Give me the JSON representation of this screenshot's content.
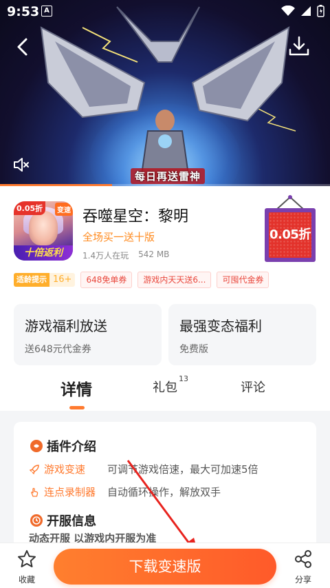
{
  "status_bar": {
    "time": "9:53",
    "a_indicator": "A"
  },
  "hero": {
    "caption": "每日再送雷神",
    "video_progress": 0.34,
    "icons": {
      "back": "back-arrow-icon",
      "download": "download-icon",
      "mute": "mute-icon"
    }
  },
  "app": {
    "title": "吞噬星空：黎明",
    "tagline": "全场买一送十版",
    "players": "1.4万人在玩",
    "size": "542 MB",
    "icon_badge_left": "0.05折",
    "icon_badge_right": "变速",
    "icon_banner": "十倍返利",
    "discount": "0.05折"
  },
  "tags": {
    "age_label": "适龄提示",
    "age_value": "16+",
    "items": [
      "648免单券",
      "游戏内天天送6...",
      "可囤代金券"
    ]
  },
  "welfare": [
    {
      "title": "游戏福利放送",
      "subtitle": "送648元代金券"
    },
    {
      "title": "最强变态福利",
      "subtitle": "免费版"
    }
  ],
  "tabs": {
    "details": "详情",
    "gifts": "礼包",
    "gifts_badge": "13",
    "comments": "评论"
  },
  "details": {
    "plugin_heading": "插件介绍",
    "features": [
      {
        "name": "游戏变速",
        "desc": "可调节游戏倍速，最大可加速5倍"
      },
      {
        "name": "连点录制器",
        "desc": "自动循环操作，解放双手"
      }
    ],
    "server_heading": "开服信息",
    "server_text": "动态开服    以游戏内开服为准"
  },
  "bottom": {
    "favorite": "收藏",
    "download": "下载变速版",
    "share": "分享"
  },
  "colors": {
    "accent": "#ff7a2f",
    "discount_red": "#e3322b",
    "discount_purple": "#7a3fae"
  }
}
